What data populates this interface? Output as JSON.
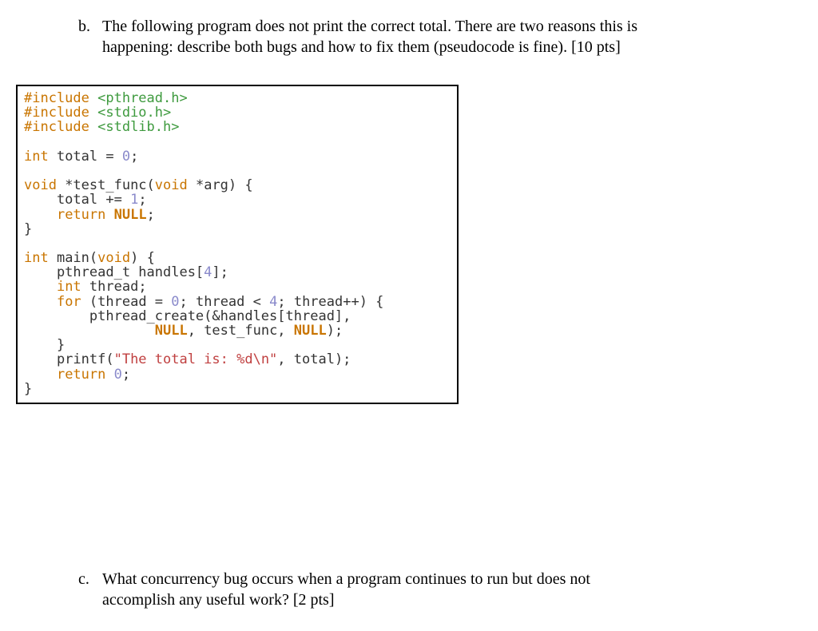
{
  "question_b": {
    "marker": "b.",
    "line1": "The following program does not print the correct total. There are two reasons this is",
    "line2": "happening: describe both bugs and how to fix them (pseudocode is fine). [10 pts]"
  },
  "question_c": {
    "marker": "c.",
    "line1": "What concurrency bug occurs when a program continues to run but does not",
    "line2": "accomplish any useful work? [2 pts]"
  },
  "code": {
    "l01_a": "#include ",
    "l01_b": "<pthread.h>",
    "l02_a": "#include ",
    "l02_b": "<stdio.h>",
    "l03_a": "#include ",
    "l03_b": "<stdlib.h>",
    "l04": "",
    "l05_a": "int",
    "l05_b": " total = ",
    "l05_c": "0",
    "l05_d": ";",
    "l06": "",
    "l07_a": "void",
    "l07_b": " *test_func(",
    "l07_c": "void",
    "l07_d": " *arg) {",
    "l08_a": "    total += ",
    "l08_b": "1",
    "l08_c": ";",
    "l09_a": "    ",
    "l09_b": "return",
    "l09_c": " ",
    "l09_d": "NULL",
    "l09_e": ";",
    "l10": "}",
    "l11": "",
    "l12_a": "int",
    "l12_b": " main(",
    "l12_c": "void",
    "l12_d": ") {",
    "l13_a": "    pthread_t handles[",
    "l13_b": "4",
    "l13_c": "];",
    "l14_a": "    ",
    "l14_b": "int",
    "l14_c": " thread;",
    "l15_a": "    ",
    "l15_b": "for",
    "l15_c": " (thread = ",
    "l15_d": "0",
    "l15_e": "; thread < ",
    "l15_f": "4",
    "l15_g": "; thread++) {",
    "l16": "        pthread_create(&handles[thread],",
    "l17_a": "                ",
    "l17_b": "NULL",
    "l17_c": ", test_func, ",
    "l17_d": "NULL",
    "l17_e": ");",
    "l18": "    }",
    "l19_a": "    printf(",
    "l19_b": "\"The total is: %d\\n\"",
    "l19_c": ", total);",
    "l20_a": "    ",
    "l20_b": "return",
    "l20_c": " ",
    "l20_d": "0",
    "l20_e": ";",
    "l21": "}"
  }
}
